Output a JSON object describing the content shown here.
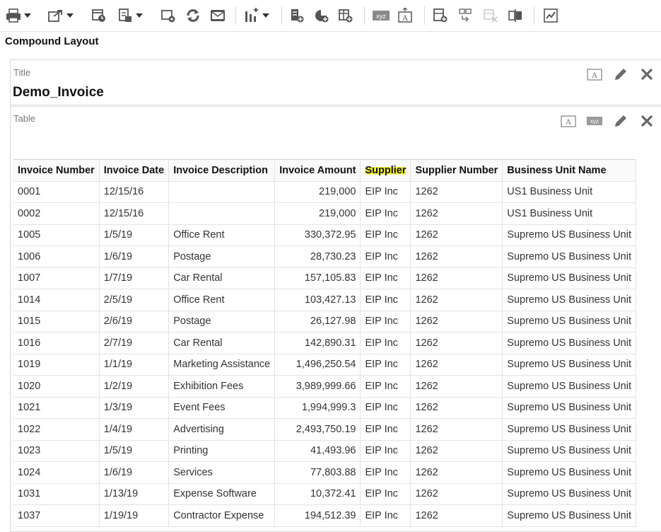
{
  "toolbar": {
    "icons": [
      "printer-icon",
      "export-icon",
      "schedule-icon",
      "send-icon",
      "job-history-icon",
      "refresh-icon",
      "email-icon",
      "chart-icon",
      "add-pivot-icon",
      "add-chart-icon",
      "add-table-icon",
      "xyz-label-icon",
      "text-icon",
      "layout-icon",
      "nested-icon",
      "remove-icon",
      "switch-icon",
      "analyze-icon"
    ]
  },
  "page": {
    "title": "Compound Layout"
  },
  "title_panel": {
    "label": "Title",
    "value": "Demo_Invoice"
  },
  "table_panel": {
    "label": "Table",
    "columns": [
      "Invoice Number",
      "Invoice Date",
      "Invoice Description",
      "Invoice Amount",
      "Supplier",
      "Supplier Number",
      "Business Unit Name"
    ],
    "rows": [
      [
        "0001",
        "12/15/16",
        "",
        "219,000",
        "EIP Inc",
        "1262",
        "US1 Business Unit"
      ],
      [
        "0002",
        "12/15/16",
        "",
        "219,000",
        "EIP Inc",
        "1262",
        "US1 Business Unit"
      ],
      [
        "1005",
        "1/5/19",
        "Office Rent",
        "330,372.95",
        "EIP Inc",
        "1262",
        "Supremo US Business Unit"
      ],
      [
        "1006",
        "1/6/19",
        "Postage",
        "28,730.23",
        "EIP Inc",
        "1262",
        "Supremo US Business Unit"
      ],
      [
        "1007",
        "1/7/19",
        "Car Rental",
        "157,105.83",
        "EIP Inc",
        "1262",
        "Supremo US Business Unit"
      ],
      [
        "1014",
        "2/5/19",
        "Office Rent",
        "103,427.13",
        "EIP Inc",
        "1262",
        "Supremo US Business Unit"
      ],
      [
        "1015",
        "2/6/19",
        "Postage",
        "26,127.98",
        "EIP Inc",
        "1262",
        "Supremo US Business Unit"
      ],
      [
        "1016",
        "2/7/19",
        "Car Rental",
        "142,890.31",
        "EIP Inc",
        "1262",
        "Supremo US Business Unit"
      ],
      [
        "1019",
        "1/1/19",
        "Marketing Assistance",
        "1,496,250.54",
        "EIP Inc",
        "1262",
        "Supremo US Business Unit"
      ],
      [
        "1020",
        "1/2/19",
        "Exhibition Fees",
        "3,989,999.66",
        "EIP Inc",
        "1262",
        "Supremo US Business Unit"
      ],
      [
        "1021",
        "1/3/19",
        "Event Fees",
        "1,994,999.3",
        "EIP Inc",
        "1262",
        "Supremo US Business Unit"
      ],
      [
        "1022",
        "1/4/19",
        "Advertising",
        "2,493,750.19",
        "EIP Inc",
        "1262",
        "Supremo US Business Unit"
      ],
      [
        "1023",
        "1/5/19",
        "Printing",
        "41,493.96",
        "EIP Inc",
        "1262",
        "Supremo US Business Unit"
      ],
      [
        "1024",
        "1/6/19",
        "Services",
        "77,803.88",
        "EIP Inc",
        "1262",
        "Supremo US Business Unit"
      ],
      [
        "1031",
        "1/13/19",
        "Expense Software",
        "10,372.41",
        "EIP Inc",
        "1262",
        "Supremo US Business Unit"
      ],
      [
        "1037",
        "1/19/19",
        "Contractor Expense",
        "194,512.39",
        "EIP Inc",
        "1262",
        "Supremo US Business Unit"
      ]
    ]
  },
  "panel_actions": [
    "text-format-icon",
    "xyz-label-icon",
    "edit-icon",
    "close-icon"
  ]
}
